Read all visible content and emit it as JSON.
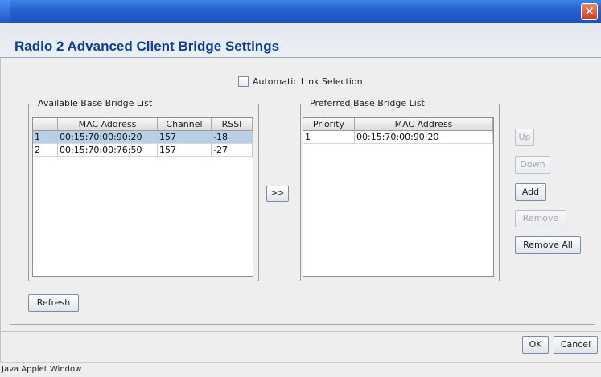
{
  "window": {
    "title": "Radio 2 Advanced Client Bridge Settings",
    "close_glyph": "✕"
  },
  "auto_link": {
    "label": "Automatic Link Selection",
    "checked": false
  },
  "available": {
    "title": "Available Base Bridge List",
    "columns": [
      "",
      "MAC Address",
      "Channel",
      "RSSI"
    ],
    "rows": [
      {
        "index": "1",
        "mac": "00:15:70:00:90:20",
        "channel": "157",
        "rssi": "-18",
        "selected": true
      },
      {
        "index": "2",
        "mac": "00:15:70:00:76:50",
        "channel": "157",
        "rssi": "-27",
        "selected": false
      }
    ]
  },
  "move_button_label": ">>",
  "preferred": {
    "title": "Preferred Base Bridge List",
    "columns": [
      "Priority",
      "MAC Address"
    ],
    "rows": [
      {
        "priority": "1",
        "mac": "00:15:70:00:90:20"
      }
    ]
  },
  "side_buttons": {
    "up": "Up",
    "down": "Down",
    "add": "Add",
    "remove": "Remove",
    "remove_all": "Remove All"
  },
  "refresh_label": "Refresh",
  "footer": {
    "ok": "OK",
    "cancel": "Cancel"
  },
  "status_text": "Java Applet Window",
  "colors": {
    "title": "#0e3f99",
    "selected_row": "#b8cfe5",
    "titlebar": "#2461cf"
  }
}
